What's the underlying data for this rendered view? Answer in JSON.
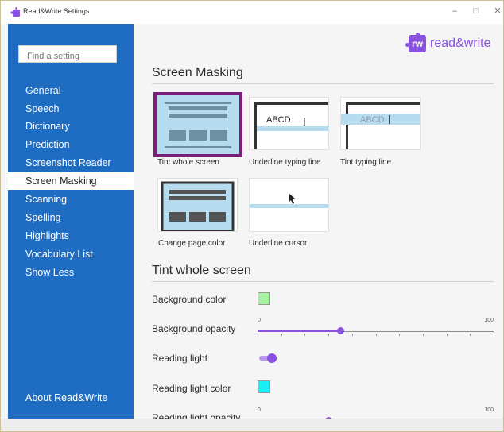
{
  "window": {
    "title": "Read&Write Settings",
    "minimize_glyph": "–",
    "maximize_glyph": "□",
    "close_glyph": "✕"
  },
  "search": {
    "placeholder": "Find a setting"
  },
  "sidebar": {
    "items": [
      {
        "label": "General"
      },
      {
        "label": "Speech"
      },
      {
        "label": "Dictionary"
      },
      {
        "label": "Prediction"
      },
      {
        "label": "Screenshot Reader"
      },
      {
        "label": "Screen Masking"
      },
      {
        "label": "Scanning"
      },
      {
        "label": "Spelling"
      },
      {
        "label": "Highlights"
      },
      {
        "label": "Vocabulary List"
      },
      {
        "label": "Show Less"
      }
    ],
    "active_index": 5,
    "about_label": "About Read&Write"
  },
  "logo": {
    "mark": "rw",
    "text": "read&write"
  },
  "masking": {
    "heading": "Screen Masking",
    "options": [
      {
        "label": "Tint whole screen",
        "selected": true
      },
      {
        "label": "Underline typing line",
        "sample": "ABCD"
      },
      {
        "label": "Tint typing line",
        "sample": "ABCD"
      },
      {
        "label": "Change page color"
      },
      {
        "label": "Underline cursor"
      }
    ]
  },
  "tint": {
    "heading": "Tint whole screen",
    "background_color_label": "Background color",
    "background_color": "#a8f0a3",
    "background_opacity_label": "Background opacity",
    "background_opacity": {
      "min": "0",
      "max": "100",
      "value": 35
    },
    "reading_light_label": "Reading light",
    "reading_light_on": true,
    "reading_light_color_label": "Reading light color",
    "reading_light_color": "#19f0f4",
    "reading_light_opacity_label": "Reading light opacity",
    "reading_light_opacity": {
      "min": "0",
      "max": "100",
      "value": 30
    }
  },
  "colors": {
    "sidebar": "#1f6cc3",
    "accent": "#8a52e0",
    "selected_border": "#7a1f79",
    "thumb_blue": "#b7dcef"
  }
}
